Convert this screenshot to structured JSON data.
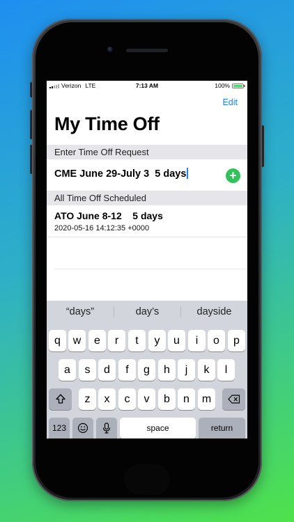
{
  "status_bar": {
    "carrier": "Verizon",
    "network": "LTE",
    "time": "7:13 AM",
    "battery": "100%"
  },
  "nav": {
    "edit_label": "Edit"
  },
  "page": {
    "title": "My Time Off"
  },
  "sections": {
    "entry_header": "Enter Time Off Request",
    "scheduled_header": "All Time Off Scheduled"
  },
  "entry": {
    "value": "CME June 29-July 3  5 days",
    "add_icon": "plus-circle-icon",
    "add_symbol": "+"
  },
  "scheduled": [
    {
      "title": "ATO June 8-12    5 days",
      "timestamp": "2020-05-16 14:12:35 +0000"
    }
  ],
  "keyboard": {
    "suggestions": [
      "“days”",
      "day’s",
      "dayside"
    ],
    "row1": [
      "q",
      "w",
      "e",
      "r",
      "t",
      "y",
      "u",
      "i",
      "o",
      "p"
    ],
    "row2": [
      "a",
      "s",
      "d",
      "f",
      "g",
      "h",
      "j",
      "k",
      "l"
    ],
    "row3": [
      "z",
      "x",
      "c",
      "v",
      "b",
      "n",
      "m"
    ],
    "numbers_label": "123",
    "space_label": "space",
    "return_label": "return",
    "shift_icon": "shift-icon",
    "delete_icon": "delete-icon",
    "emoji_icon": "emoji-icon",
    "mic_icon": "microphone-icon"
  },
  "colors": {
    "accent": "#1a83f7",
    "add_button": "#33c15a",
    "battery": "#4cd964"
  }
}
